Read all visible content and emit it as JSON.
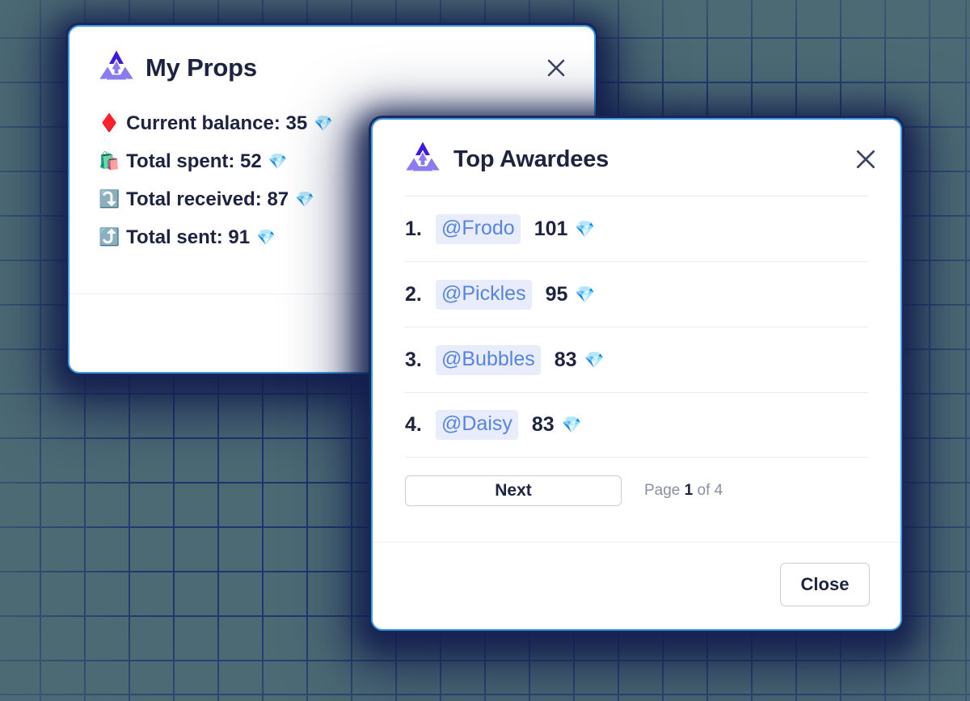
{
  "theme": {
    "background_color": "#4c6a74",
    "grid_line_color": "#1d3570",
    "modal_border_color": "#3f9bdd",
    "text_color": "#1d2340",
    "mention_bg": "#e9ecfb",
    "mention_text": "#5685e0",
    "muted_text": "#8b8fa3",
    "logo_dark": "#3a1ae0",
    "logo_light": "#8b7bf0"
  },
  "my_props_modal": {
    "title": "My Props",
    "logo_name": "props-recycle-logo",
    "close_icon": "close-icon",
    "stats": [
      {
        "emoji": "♦️",
        "emoji_name": "red-diamond-suit-emoji",
        "label": "Current balance:",
        "value": "35",
        "gem": "💎"
      },
      {
        "emoji": "🛍️",
        "emoji_name": "shopping-bags-emoji",
        "label": "Total spent:",
        "value": "52",
        "gem": "💎"
      },
      {
        "emoji": "⤵️",
        "emoji_name": "arrow-down-curve-emoji",
        "label": "Total received:",
        "value": "87",
        "gem": "💎"
      },
      {
        "emoji": "⤴️",
        "emoji_name": "arrow-up-curve-emoji",
        "label": "Total sent:",
        "value": "91",
        "gem": "💎"
      }
    ]
  },
  "top_awardees_modal": {
    "title": "Top Awardees",
    "logo_name": "props-recycle-logo",
    "close_icon": "close-icon",
    "awardees": [
      {
        "rank": "1.",
        "handle": "@Frodo",
        "amount": "101",
        "gem": "💎"
      },
      {
        "rank": "2.",
        "handle": "@Pickles",
        "amount": "95",
        "gem": "💎"
      },
      {
        "rank": "3.",
        "handle": "@Bubbles",
        "amount": "83",
        "gem": "💎"
      },
      {
        "rank": "4.",
        "handle": "@Daisy",
        "amount": "83",
        "gem": "💎"
      }
    ],
    "pagination": {
      "next_label": "Next",
      "page_prefix": "Page",
      "current_page": "1",
      "page_suffix": "of 4"
    },
    "footer": {
      "close_label": "Close"
    }
  }
}
